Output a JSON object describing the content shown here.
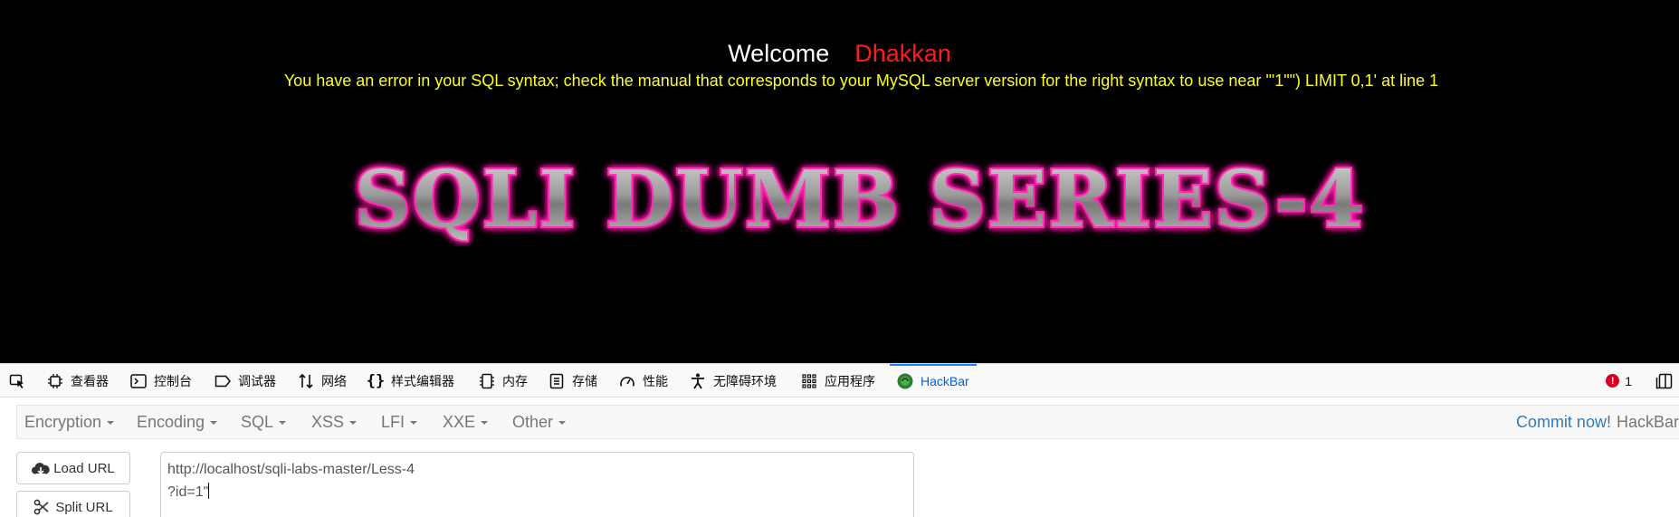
{
  "page": {
    "welcome": "Welcome",
    "user_name": "Dhakkan",
    "error_message": "You have an error in your SQL syntax; check the manual that corresponds to your MySQL server version for the right syntax to use near '\"1\"\") LIMIT 0,1' at line 1",
    "banner_title": "SQLI DUMB SERIES-4",
    "colors": {
      "background": "#000000",
      "welcome": "#ffffff",
      "user_name": "#ff1a1a",
      "error": "#ffff1a",
      "banner_glow": "#ff1aa8"
    }
  },
  "devtools": {
    "tabs": [
      {
        "label": "查看器",
        "icon": "inspector-icon"
      },
      {
        "label": "控制台",
        "icon": "console-icon"
      },
      {
        "label": "调试器",
        "icon": "debugger-icon"
      },
      {
        "label": "网络",
        "icon": "network-icon"
      },
      {
        "label": "样式编辑器",
        "icon": "style-editor-icon"
      },
      {
        "label": "内存",
        "icon": "memory-icon"
      },
      {
        "label": "存储",
        "icon": "storage-icon"
      },
      {
        "label": "性能",
        "icon": "performance-icon"
      },
      {
        "label": "无障碍环境",
        "icon": "accessibility-icon"
      },
      {
        "label": "应用程序",
        "icon": "application-icon"
      },
      {
        "label": "HackBar",
        "icon": "hackbar-icon",
        "active": true
      }
    ],
    "error_count": "1",
    "accent_color": "#0a84ff"
  },
  "hackbar": {
    "menus": [
      "Encryption",
      "Encoding",
      "SQL",
      "XSS",
      "LFI",
      "XXE",
      "Other"
    ],
    "commit_label": "Commit now!",
    "brand": "HackBar",
    "load_url_label": "Load URL",
    "split_url_label": "Split URL",
    "url_line_1": "http://localhost/sqli-labs-master/Less-4",
    "url_line_2": "?id=1\""
  }
}
